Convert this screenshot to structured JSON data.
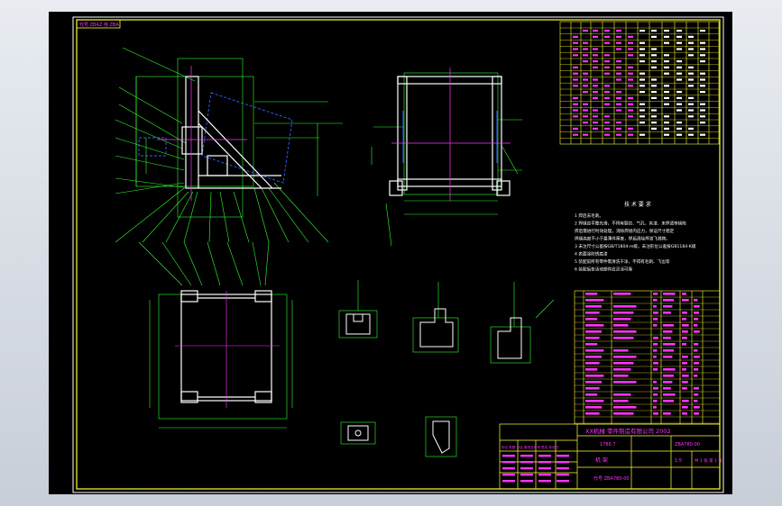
{
  "drawing": {
    "corner_label": "代号 ZBAZ 用 ZBA",
    "tech_title": "技 术 要 求",
    "tech_notes": [
      "1 焊后去毛刺。",
      "2 焊缝应平整光滑，不得有裂纹、气孔、夹渣、未焊透等缺陷",
      "  焊后需进行时效处理，消除焊接内应力，保证尺寸稳定",
      "  焊缝高度不小于最薄件厚度，焊后清除焊渣飞溅物。",
      "3 未注尺寸公差按GB/T1804-m级，未注形位公差按GB1184-K级",
      "4 表面涂防锈底漆",
      "5 装配前所有零件需清洗干净，不得有毛刺、飞边等",
      "6 装配后各活动部件应灵活可靠"
    ],
    "title_block": {
      "company": "XX机械  零件制造有限公司  2002",
      "part_no": "1780.7",
      "drawing_no": "ZBA780-00",
      "name": "机 架",
      "scale": "1:5",
      "sheet": "共 1 张 第 1 张",
      "footer": "代号 ZBA780-00"
    },
    "revision_block_label": "标记 处数 分区 更改文件号 签名 年月日"
  }
}
